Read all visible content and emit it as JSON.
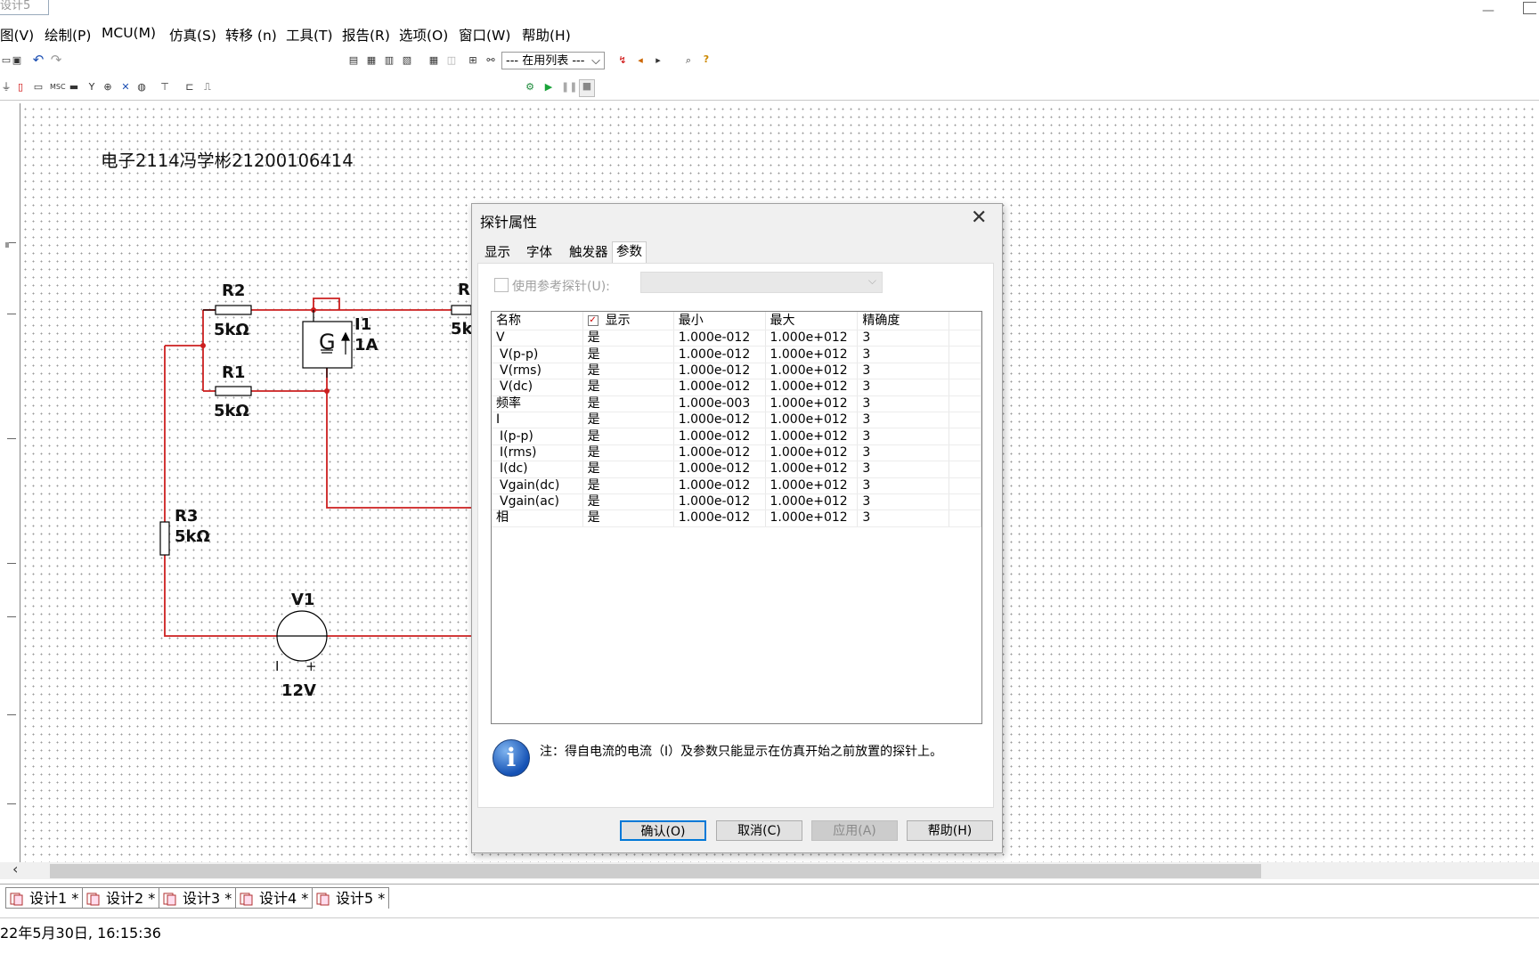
{
  "window": {
    "tab_title": "设计5"
  },
  "menu": [
    "图(V)",
    "绘制(P)",
    "MCU(M)",
    "仿真(S)",
    "转移 (n)",
    "工具(T)",
    "报告(R)",
    "选项(O)",
    "窗口(W)",
    "帮助(H)"
  ],
  "toolbar": {
    "in_use_list": "--- 在用列表 ---"
  },
  "canvas": {
    "note": "电子2114冯学彬21200106414",
    "components": {
      "r2": {
        "name": "R2",
        "value": "5kΩ"
      },
      "r1": {
        "name": "R1",
        "value": "5kΩ"
      },
      "r3": {
        "name": "R3",
        "value": "5kΩ"
      },
      "r_partial": {
        "name": "R",
        "value": "5k"
      },
      "i1": {
        "name": "I1",
        "value": "1A",
        "symbol": "G"
      },
      "v1": {
        "name": "V1",
        "value": "12V",
        "minus": "I",
        "plus": "+"
      }
    }
  },
  "dialog": {
    "title": "探针属性",
    "tabs": [
      "显示",
      "字体",
      "触发器",
      "参数"
    ],
    "active_tab": "参数",
    "use_reference_label": "使用参考探针(U):",
    "columns": [
      "名称",
      "显示",
      "最小",
      "最大",
      "精确度"
    ],
    "rows": [
      {
        "name": "V",
        "show": "是",
        "min": "1.000e-012",
        "max": "1.000e+012",
        "precision": "3",
        "indent": false
      },
      {
        "name": "V(p-p)",
        "show": "是",
        "min": "1.000e-012",
        "max": "1.000e+012",
        "precision": "3",
        "indent": true
      },
      {
        "name": "V(rms)",
        "show": "是",
        "min": "1.000e-012",
        "max": "1.000e+012",
        "precision": "3",
        "indent": true
      },
      {
        "name": "V(dc)",
        "show": "是",
        "min": "1.000e-012",
        "max": "1.000e+012",
        "precision": "3",
        "indent": true
      },
      {
        "name": "频率",
        "show": "是",
        "min": "1.000e-003",
        "max": "1.000e+012",
        "precision": "3",
        "indent": false
      },
      {
        "name": "I",
        "show": "是",
        "min": "1.000e-012",
        "max": "1.000e+012",
        "precision": "3",
        "indent": false
      },
      {
        "name": "I(p-p)",
        "show": "是",
        "min": "1.000e-012",
        "max": "1.000e+012",
        "precision": "3",
        "indent": true
      },
      {
        "name": "I(rms)",
        "show": "是",
        "min": "1.000e-012",
        "max": "1.000e+012",
        "precision": "3",
        "indent": true
      },
      {
        "name": "I(dc)",
        "show": "是",
        "min": "1.000e-012",
        "max": "1.000e+012",
        "precision": "3",
        "indent": true
      },
      {
        "name": "Vgain(dc)",
        "show": "是",
        "min": "1.000e-012",
        "max": "1.000e+012",
        "precision": "3",
        "indent": true
      },
      {
        "name": "Vgain(ac)",
        "show": "是",
        "min": "1.000e-012",
        "max": "1.000e+012",
        "precision": "3",
        "indent": true
      },
      {
        "name": "相",
        "show": "是",
        "min": "1.000e-012",
        "max": "1.000e+012",
        "precision": "3",
        "indent": false
      }
    ],
    "note": "注：得自电流的电流（I）及参数只能显示在仿真开始之前放置的探针上。",
    "buttons": {
      "ok": "确认(O)",
      "cancel": "取消(C)",
      "apply": "应用(A)",
      "help": "帮助(H)"
    }
  },
  "design_tabs": [
    "设计1 *",
    "设计2 *",
    "设计3 *",
    "设计4 *",
    "设计5 *"
  ],
  "status": {
    "timestamp": "22年5月30日, 16:15:36"
  },
  "colors": {
    "wire": "#cc1f1f",
    "accent": "#0078d7"
  }
}
